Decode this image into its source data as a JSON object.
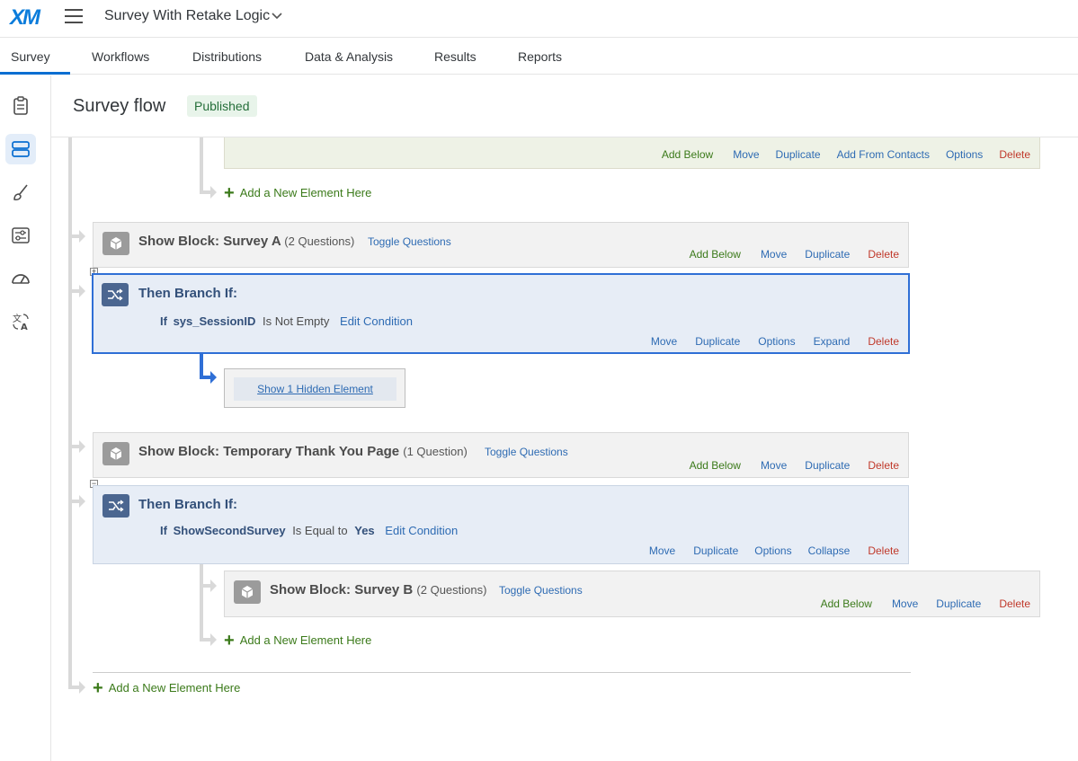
{
  "header": {
    "logo": "XM",
    "survey_title": "Survey With Retake Logic",
    "title_dropdown_icon": "chevron-down-icon"
  },
  "tabs": [
    {
      "label": "Survey",
      "active": true
    },
    {
      "label": "Workflows"
    },
    {
      "label": "Distributions"
    },
    {
      "label": "Data & Analysis"
    },
    {
      "label": "Results"
    },
    {
      "label": "Reports"
    }
  ],
  "left_rail": [
    {
      "icon": "clipboard-icon",
      "active": false
    },
    {
      "icon": "survey-flow-icon",
      "active": true
    },
    {
      "icon": "paintbrush-icon",
      "active": false
    },
    {
      "icon": "survey-options-icon",
      "active": false
    },
    {
      "icon": "dashboard-gauge-icon",
      "active": false
    },
    {
      "icon": "translate-icon",
      "active": false
    }
  ],
  "page": {
    "title": "Survey flow",
    "status": "Published"
  },
  "flow": {
    "top_element": {
      "actions": [
        "Add Below",
        "Move",
        "Duplicate",
        "Add From Contacts",
        "Options",
        "Delete"
      ]
    },
    "add_new_label": "Add a New Element Here",
    "block_a": {
      "prefix": "Show Block:",
      "name": "Survey A",
      "count": "(2 Questions)",
      "toggle": "Toggle Questions",
      "actions": [
        "Add Below",
        "Move",
        "Duplicate",
        "Delete"
      ]
    },
    "branch_1": {
      "title": "Then Branch If:",
      "cond_if": "If",
      "cond_field": "sys_SessionID",
      "cond_op": "Is Not Empty",
      "cond_value": "",
      "edit": "Edit Condition",
      "actions": [
        "Move",
        "Duplicate",
        "Options",
        "Expand",
        "Delete"
      ]
    },
    "hidden_element": "Show 1 Hidden Element",
    "block_thanks": {
      "prefix": "Show Block:",
      "name": "Temporary Thank You Page",
      "count": "(1 Question)",
      "toggle": "Toggle Questions",
      "actions": [
        "Add Below",
        "Move",
        "Duplicate",
        "Delete"
      ]
    },
    "branch_2": {
      "title": "Then Branch If:",
      "cond_if": "If",
      "cond_field": "ShowSecondSurvey",
      "cond_op": "Is Equal to",
      "cond_value": "Yes",
      "edit": "Edit Condition",
      "actions": [
        "Move",
        "Duplicate",
        "Options",
        "Collapse",
        "Delete"
      ]
    },
    "block_b": {
      "prefix": "Show Block:",
      "name": "Survey B",
      "count": "(2 Questions)",
      "toggle": "Toggle Questions",
      "actions": [
        "Add Below",
        "Move",
        "Duplicate",
        "Delete"
      ]
    }
  },
  "colors": {
    "accent": "#0a6ed1",
    "add_green": "#3b7a1a",
    "delete_red": "#c0392b",
    "link_blue": "#2e6bb3",
    "branch_bg": "#e7edf6",
    "selected_border": "#2f6fd6"
  }
}
